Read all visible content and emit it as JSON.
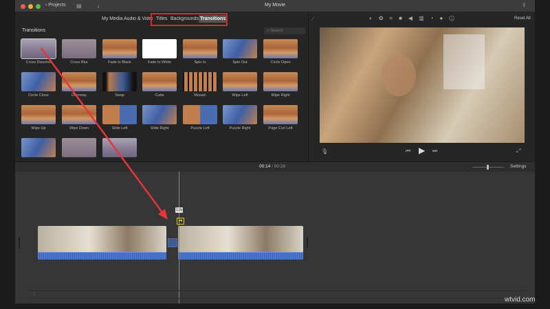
{
  "window": {
    "title": "My Movie",
    "projects_label": "Projects"
  },
  "tabs": [
    {
      "label": "My Media"
    },
    {
      "label": "Audio & Video"
    },
    {
      "label": "Titles"
    },
    {
      "label": "Backgrounds"
    },
    {
      "label": "Transitions",
      "selected": true
    }
  ],
  "browser": {
    "heading": "Transitions",
    "search_placeholder": "Search",
    "items": [
      {
        "label": "Cross Dissolve",
        "style": "dissolve"
      },
      {
        "label": "Cross Blur",
        "style": "blur"
      },
      {
        "label": "Fade to Black",
        "style": "warm"
      },
      {
        "label": "Fade to White",
        "style": "white"
      },
      {
        "label": "Spin In",
        "style": "warm"
      },
      {
        "label": "Spin Out",
        "style": "blue"
      },
      {
        "label": "Circle Open",
        "style": "warm"
      },
      {
        "label": "Circle Close",
        "style": "blue"
      },
      {
        "label": "Doorway",
        "style": "warm"
      },
      {
        "label": "Swap",
        "style": "dark"
      },
      {
        "label": "Cube",
        "style": "warm"
      },
      {
        "label": "Mosaic",
        "style": "mosaic"
      },
      {
        "label": "Wipe Left",
        "style": "warm"
      },
      {
        "label": "Wipe Right",
        "style": "warm"
      },
      {
        "label": "Wipe Up",
        "style": "warm"
      },
      {
        "label": "Wipe Down",
        "style": "warm"
      },
      {
        "label": "Slide Left",
        "style": "split"
      },
      {
        "label": "Slide Right",
        "style": "blue"
      },
      {
        "label": "Puzzle Left",
        "style": "split"
      },
      {
        "label": "Puzzle Right",
        "style": "blue"
      },
      {
        "label": "Page Curl Left",
        "style": "warm"
      },
      {
        "label": "",
        "style": "blue"
      },
      {
        "label": "",
        "style": "blur"
      },
      {
        "label": "",
        "style": "dissolve"
      }
    ]
  },
  "viewer": {
    "reset_label": "Reset All"
  },
  "timeline": {
    "current_time": "00:14",
    "separator": "/",
    "total_time": "00:28",
    "settings_label": "Settings",
    "transition_duration": "1.0s"
  },
  "colors": {
    "highlight_box": "#e0262b",
    "arrow": "#e8343a",
    "accent_yellow": "#e3c62a",
    "audio_blue": "#4a78cf"
  }
}
